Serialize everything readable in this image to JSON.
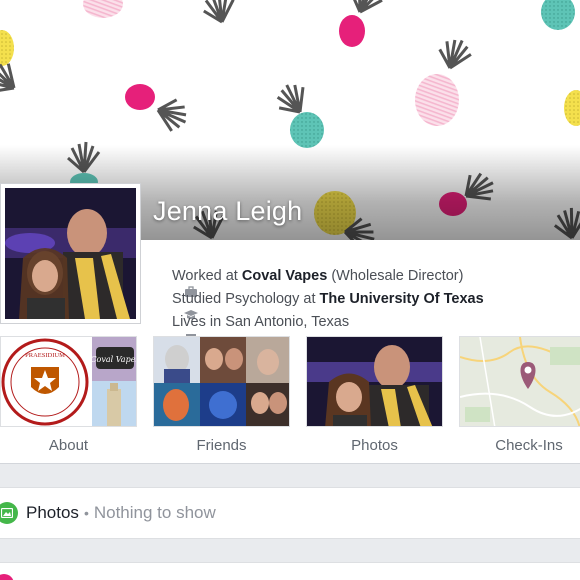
{
  "profile": {
    "name": "Jenna Leigh"
  },
  "intro": [
    {
      "icon": "briefcase-icon",
      "prefix": "Worked at ",
      "bold": "Coval Vapes",
      "suffix": " (Wholesale Director)"
    },
    {
      "icon": "graduation-cap-icon",
      "prefix": "Studied Psychology at ",
      "bold": "The University Of Texas",
      "suffix": ""
    },
    {
      "icon": "home-icon",
      "prefix": "Lives in San Antonio, Texas",
      "bold": "",
      "suffix": ""
    }
  ],
  "tiles": [
    {
      "label": "About"
    },
    {
      "label": "Friends"
    },
    {
      "label": "Photos"
    },
    {
      "label": "Check-Ins"
    }
  ],
  "about_tile": {
    "seal_text": "PRAESIDIUM",
    "sticker_text": "Coval Vapes"
  },
  "photos_section": {
    "title": "Photos",
    "separator": "•",
    "empty_text": "Nothing to show"
  },
  "colors": {
    "pineapple_pink": "#e6207a",
    "pineapple_teal": "#5ec4b6",
    "pineapple_yellow": "#f4e04d",
    "pineapple_stripe": "#f5b7cf",
    "leaf_gray": "#555555",
    "map_pin": "#9b5a78",
    "photos_green": "#44b74a",
    "ut_orange": "#bf5700"
  }
}
